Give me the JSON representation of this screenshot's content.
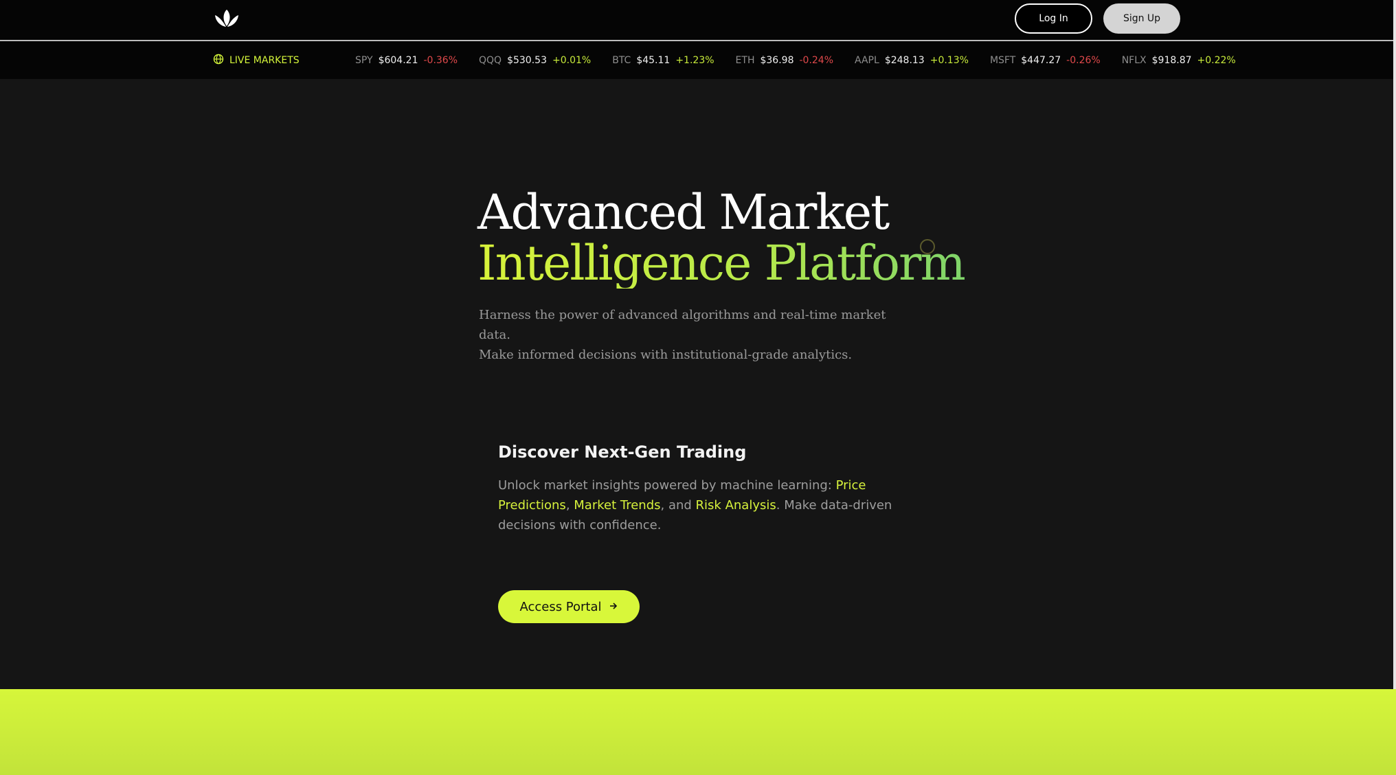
{
  "nav": {
    "logo": "lotus-logo",
    "login_label": "Log In",
    "signup_label": "Sign Up"
  },
  "ticker": {
    "live_label": "LIVE MARKETS",
    "items": [
      {
        "symbol": "SPY",
        "price": "$604.21",
        "change": "-0.36%",
        "direction": "down"
      },
      {
        "symbol": "QQQ",
        "price": "$530.53",
        "change": "+0.01%",
        "direction": "up"
      },
      {
        "symbol": "BTC",
        "price": "$45.11",
        "change": "+1.23%",
        "direction": "up"
      },
      {
        "symbol": "ETH",
        "price": "$36.98",
        "change": "-0.24%",
        "direction": "down"
      },
      {
        "symbol": "AAPL",
        "price": "$248.13",
        "change": "+0.13%",
        "direction": "up"
      },
      {
        "symbol": "MSFT",
        "price": "$447.27",
        "change": "-0.26%",
        "direction": "down"
      },
      {
        "symbol": "NFLX",
        "price": "$918.87",
        "change": "+0.22%",
        "direction": "up"
      }
    ]
  },
  "hero": {
    "title_line1": "Advanced Market",
    "title_line2": "Intelligence Platform",
    "subtitle_line1": "Harness the power of advanced algorithms and real-time market data.",
    "subtitle_line2": "Make informed decisions with institutional-grade analytics."
  },
  "feature": {
    "title": "Discover Next-Gen Trading",
    "body_intro": "Unlock market insights powered by machine learning: ",
    "hl1": "Price Predictions",
    "sep1": ", ",
    "hl2": "Market Trends",
    "sep2": ", and ",
    "hl3": "Risk Analysis",
    "body_outro": ". Make data-driven decisions with confidence.",
    "cta_label": "Access Portal",
    "cta_icon": "arrow-right-icon"
  },
  "colors": {
    "accent": "#d8f73a",
    "background": "#151515",
    "nav_background": "#050505",
    "down": "#e0494b",
    "up": "#c7ea3a"
  }
}
